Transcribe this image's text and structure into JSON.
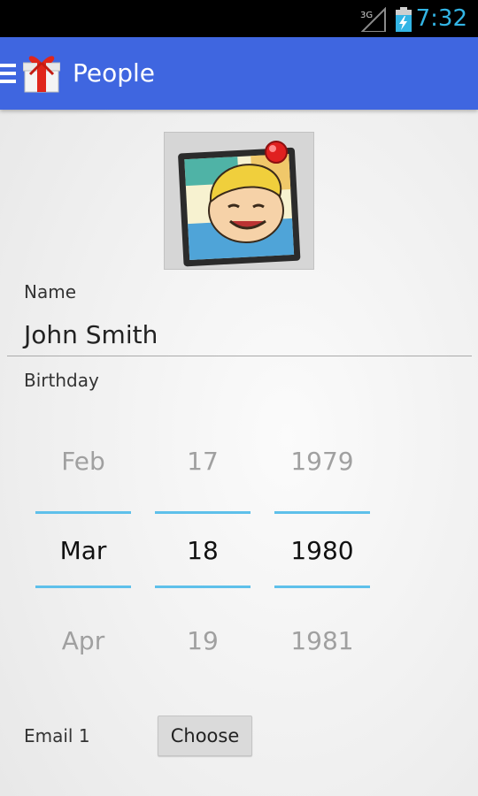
{
  "status_bar": {
    "network": "3G",
    "time": "7:32"
  },
  "action_bar": {
    "title": "People"
  },
  "form": {
    "name_label": "Name",
    "name_value": "John Smith",
    "birthday_label": "Birthday",
    "email_label": "Email 1",
    "choose_label": "Choose"
  },
  "birthday_picker": {
    "month": {
      "prev": "Feb",
      "selected": "Mar",
      "next": "Apr"
    },
    "day": {
      "prev": "17",
      "selected": "18",
      "next": "19"
    },
    "year": {
      "prev": "1979",
      "selected": "1980",
      "next": "1981"
    }
  },
  "colors": {
    "accent": "#33b5e5",
    "action_bar": "#3f66e0",
    "picker_line": "#5ec0ea"
  }
}
